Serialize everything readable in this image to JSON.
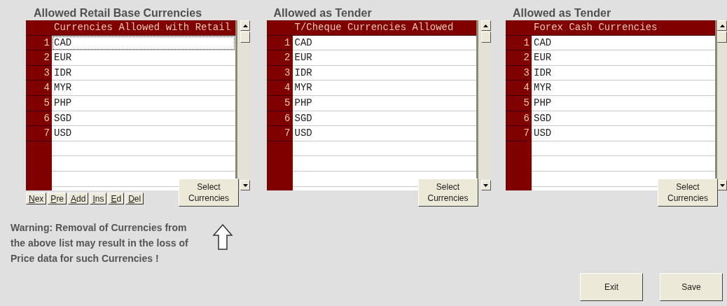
{
  "panels": [
    {
      "title": "Allowed Retail Base Currencies",
      "column": "Currencies Allowed with Retail",
      "button": "Select Currencies",
      "nav_buttons": [
        "Nex",
        "Pre",
        "Add",
        "Ins",
        "Ed",
        "Del"
      ],
      "rows": [
        {
          "number": "1",
          "code": "CAD",
          "selected": true
        },
        {
          "number": "2",
          "code": "EUR",
          "selected": false
        },
        {
          "number": "3",
          "code": "IDR",
          "selected": false
        },
        {
          "number": "4",
          "code": "MYR",
          "selected": false
        },
        {
          "number": "5",
          "code": "PHP",
          "selected": false
        },
        {
          "number": "6",
          "code": "SGD",
          "selected": false
        },
        {
          "number": "7",
          "code": "USD",
          "selected": false
        }
      ]
    },
    {
      "title": "Allowed as Tender",
      "column": "T/Cheque Currencies Allowed",
      "button": "Select Currencies",
      "rows": [
        {
          "number": "1",
          "code": "CAD",
          "selected": false
        },
        {
          "number": "2",
          "code": "EUR",
          "selected": false
        },
        {
          "number": "3",
          "code": "IDR",
          "selected": false
        },
        {
          "number": "4",
          "code": "MYR",
          "selected": false
        },
        {
          "number": "5",
          "code": "PHP",
          "selected": false
        },
        {
          "number": "6",
          "code": "SGD",
          "selected": false
        },
        {
          "number": "7",
          "code": "USD",
          "selected": false
        }
      ]
    },
    {
      "title": "Allowed as Tender",
      "column": "Forex Cash Currencies",
      "button": "Select Currencies",
      "rows": [
        {
          "number": "1",
          "code": "CAD",
          "selected": false
        },
        {
          "number": "2",
          "code": "EUR",
          "selected": false
        },
        {
          "number": "3",
          "code": "IDR",
          "selected": false
        },
        {
          "number": "4",
          "code": "MYR",
          "selected": false
        },
        {
          "number": "5",
          "code": "PHP",
          "selected": false
        },
        {
          "number": "6",
          "code": "SGD",
          "selected": false
        },
        {
          "number": "7",
          "code": "USD",
          "selected": false
        }
      ]
    }
  ],
  "warning": "Warning: Removal of Currencies from the above list may result in the loss of Price data for such Currencies !",
  "buttons": [
    "Exit",
    "Save"
  ]
}
